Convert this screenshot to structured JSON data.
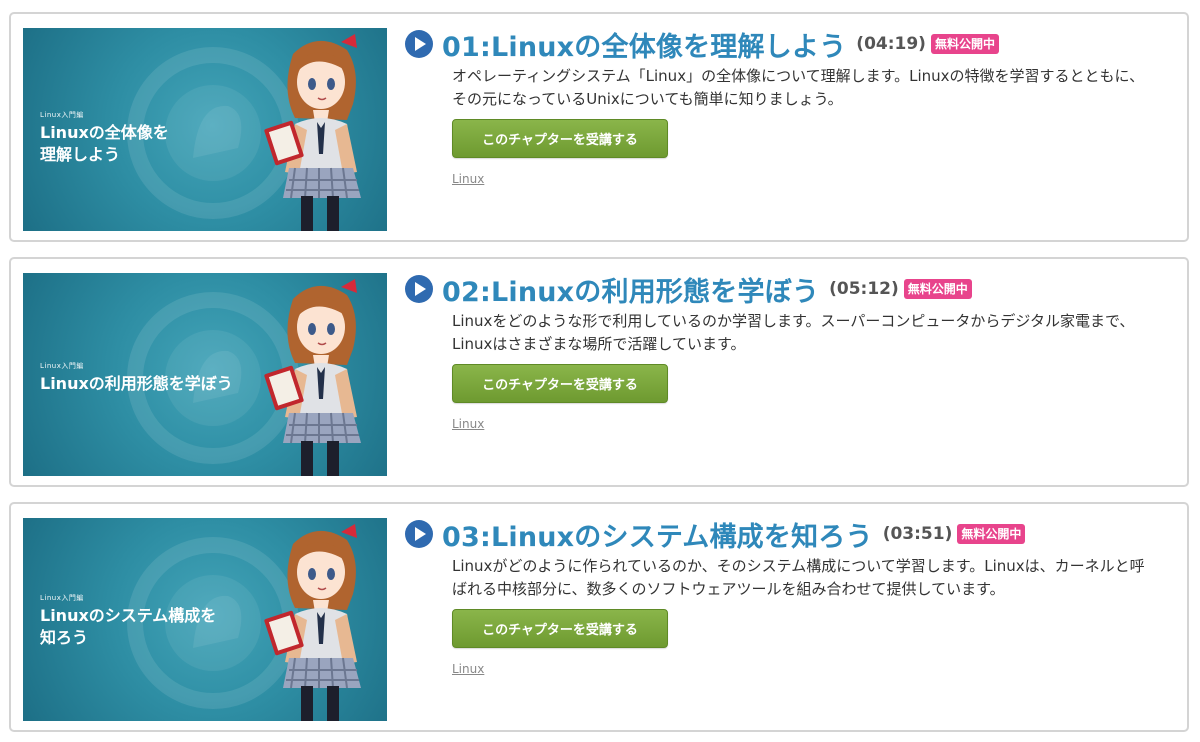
{
  "chapters": [
    {
      "title": "01:Linuxの全体像を理解しよう",
      "duration": "(04:19)",
      "badge": "無料公開中",
      "description": "オペレーティングシステム「Linux」の全体像について理解します。Linuxの特徴を学習するとともに、その元になっているUnixについても簡単に知りましょう。",
      "button": "このチャプターを受講する",
      "tag": "Linux",
      "thumb_small": "Linux入門編",
      "thumb_title": "Linuxの全体像を\n理解しよう"
    },
    {
      "title": "02:Linuxの利用形態を学ぼう",
      "duration": "(05:12)",
      "badge": "無料公開中",
      "description": "Linuxをどのような形で利用しているのか学習します。スーパーコンピュータからデジタル家電まで、Linuxはさまざまな場所で活躍しています。",
      "button": "このチャプターを受講する",
      "tag": "Linux",
      "thumb_small": "Linux入門編",
      "thumb_title": "Linuxの利用形態を学ぼう"
    },
    {
      "title": "03:Linuxのシステム構成を知ろう",
      "duration": "(03:51)",
      "badge": "無料公開中",
      "description": "Linuxがどのように作られているのか、そのシステム構成について学習します。Linuxは、カーネルと呼ばれる中核部分に、数多くのソフトウェアツールを組み合わせて提供しています。",
      "button": "このチャプターを受講する",
      "tag": "Linux",
      "thumb_small": "Linux入門編",
      "thumb_title": "Linuxのシステム構成を\n知ろう"
    }
  ],
  "colors": {
    "title": "#2f88ba",
    "badge": "#e8448c",
    "button": "#7aa63c",
    "thumb": "#2e8ea4"
  },
  "icons": {
    "play": "play-circle-icon",
    "thumbnail_character": "anime-girl-with-book-illustration"
  }
}
